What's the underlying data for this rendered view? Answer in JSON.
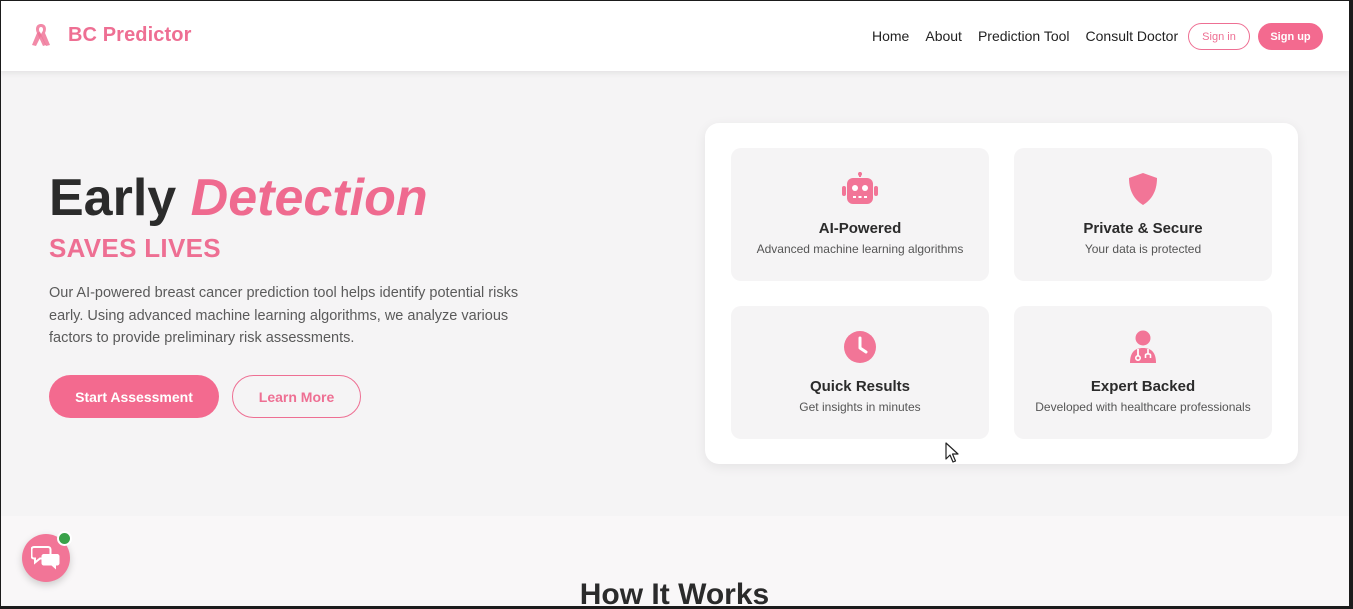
{
  "brand": {
    "name": "BC Predictor",
    "logo_icon": "pink-ribbon-icon"
  },
  "nav": {
    "items": [
      {
        "label": "Home"
      },
      {
        "label": "About"
      },
      {
        "label": "Prediction Tool"
      },
      {
        "label": "Consult Doctor"
      }
    ],
    "signin_label": "Sign in",
    "signup_label": "Sign up"
  },
  "hero": {
    "title_plain": "Early",
    "title_accent": "Detection",
    "subtitle": "SAVES LIVES",
    "description": "Our AI-powered breast cancer prediction tool helps identify potential risks early. Using advanced machine learning algorithms, we analyze various factors to provide preliminary risk assessments.",
    "primary_button": "Start Assessment",
    "secondary_button": "Learn More"
  },
  "features": [
    {
      "icon": "robot-icon",
      "title": "AI-Powered",
      "text": "Advanced machine learning algorithms"
    },
    {
      "icon": "shield-icon",
      "title": "Private & Secure",
      "text": "Your data is protected"
    },
    {
      "icon": "clock-icon",
      "title": "Quick Results",
      "text": "Get insights in minutes"
    },
    {
      "icon": "doctor-icon",
      "title": "Expert Backed",
      "text": "Developed with healthcare professionals"
    }
  ],
  "how_it_works": {
    "title": "How It Works"
  },
  "chat": {
    "icon": "chat-bubbles-icon",
    "status": "online"
  },
  "colors": {
    "accent": "#ef6a8f",
    "background": "#f5f4f5",
    "status_online": "#3aa24a"
  }
}
